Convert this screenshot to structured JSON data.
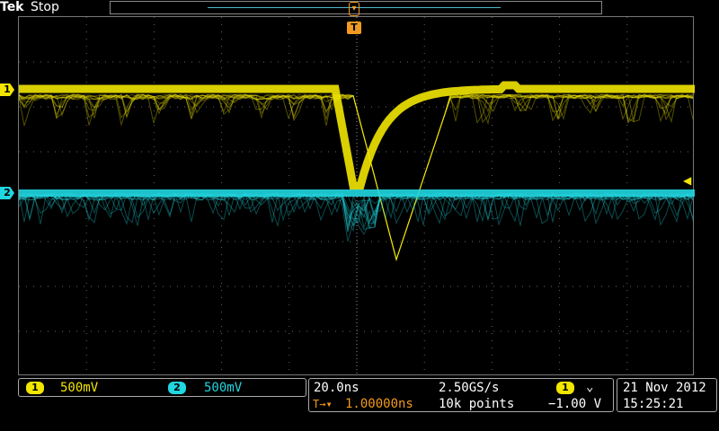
{
  "header": {
    "brand": "Tek",
    "state": "Stop"
  },
  "trigger_marker": {
    "label": "T"
  },
  "channels": [
    {
      "id": "1",
      "marker_label": "1",
      "scale": "500mV",
      "color": "#f2e600"
    },
    {
      "id": "2",
      "marker_label": "2",
      "scale": "500mV",
      "color": "#20d6e0"
    }
  ],
  "timebase": {
    "horizontal_scale": "20.0ns",
    "sample_rate": "2.50GS/s",
    "trigger_delay": "1.00000ns",
    "record_length": "10k points",
    "trigger_source": "1",
    "trigger_slope_icon": "falling-edge-icon",
    "trigger_level": "−1.00 V"
  },
  "datetime": {
    "date": "21 Nov 2012",
    "time": "15:25:21"
  },
  "colors": {
    "accent_orange": "#f39a1e",
    "grid": "#666666",
    "background": "#000000"
  }
}
